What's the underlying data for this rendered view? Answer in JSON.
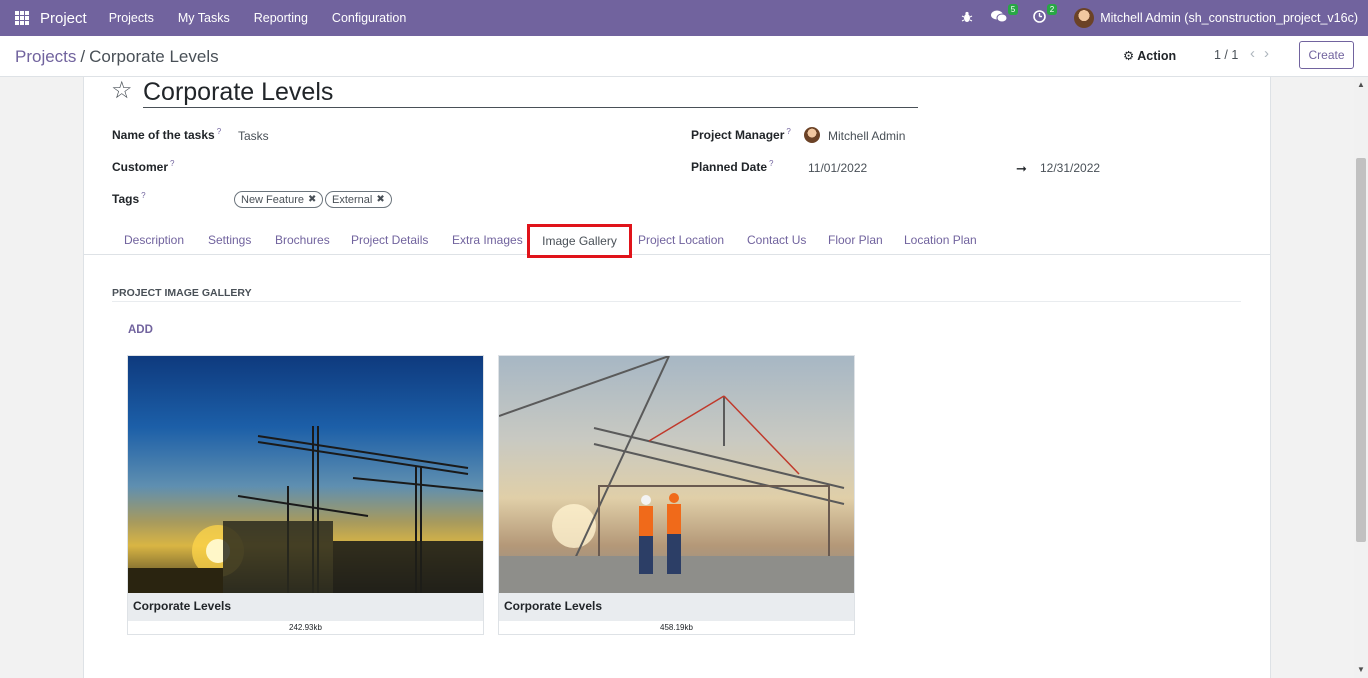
{
  "navbar": {
    "brand": "Project",
    "menu": [
      "Projects",
      "My Tasks",
      "Reporting",
      "Configuration"
    ],
    "messages_count": "5",
    "activities_count": "2",
    "user": "Mitchell Admin (sh_construction_project_v16c)"
  },
  "control": {
    "breadcrumb_parent": "Projects",
    "breadcrumb_current": "Corporate Levels",
    "action_label": "Action",
    "pager": "1 / 1",
    "create_label": "Create"
  },
  "form": {
    "title": "Corporate Levels",
    "tasks_label": "Name of the tasks",
    "tasks_value": "Tasks",
    "customer_label": "Customer",
    "tags_label": "Tags",
    "tags": [
      "New Feature",
      "External"
    ],
    "manager_label": "Project Manager",
    "manager_value": "Mitchell Admin",
    "planned_label": "Planned Date",
    "planned_start": "11/01/2022",
    "planned_end": "12/31/2022",
    "help_mark": "?"
  },
  "tabs": [
    "Description",
    "Settings",
    "Brochures",
    "Project Details",
    "Extra Images",
    "Image Gallery",
    "Project Location",
    "Contact Us",
    "Floor Plan",
    "Location Plan"
  ],
  "active_tab": "Image Gallery",
  "gallery": {
    "section_title": "PROJECT IMAGE GALLERY",
    "add_label": "ADD",
    "images": [
      {
        "caption": "Corporate Levels",
        "size": "242.93kb"
      },
      {
        "caption": "Corporate Levels",
        "size": "458.19kb"
      }
    ]
  },
  "colors": {
    "navbar": "#71639e",
    "accent": "#71639e",
    "highlight_border": "#e0131a"
  }
}
